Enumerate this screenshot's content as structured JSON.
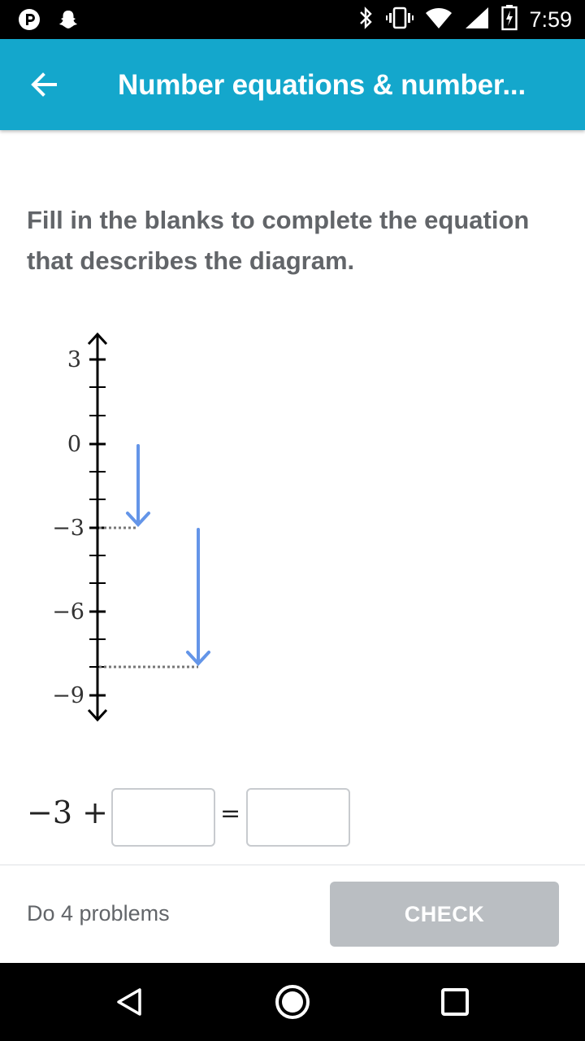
{
  "status_bar": {
    "time": "7:59",
    "left_icons": [
      "pandora-icon",
      "snapchat-icon"
    ],
    "right_icons": [
      "bluetooth-icon",
      "vibrate-icon",
      "wifi-icon",
      "signal-icon",
      "battery-charging-icon"
    ]
  },
  "app_bar": {
    "title": "Number equations & number...",
    "back_icon": "arrow-left-icon",
    "color": "#14a7cc"
  },
  "question": {
    "text": "Fill in the blanks to complete the equation that describes the diagram."
  },
  "diagram": {
    "axis_labels": [
      "3",
      "0",
      "−3",
      "−6",
      "−9"
    ],
    "arrows": [
      {
        "from": 0,
        "to": -3
      },
      {
        "from": -3,
        "to": -8
      }
    ],
    "arrow_color": "#6495e8"
  },
  "equation": {
    "start": "−3 +",
    "equals": "=",
    "blank1_value": "",
    "blank2_value": ""
  },
  "footer": {
    "problems_label": "Do 4 problems",
    "check_label": "CHECK",
    "check_color": "#babec2"
  },
  "nav_bar": {
    "icons": [
      "back-triangle-icon",
      "home-circle-icon",
      "recents-square-icon"
    ]
  }
}
